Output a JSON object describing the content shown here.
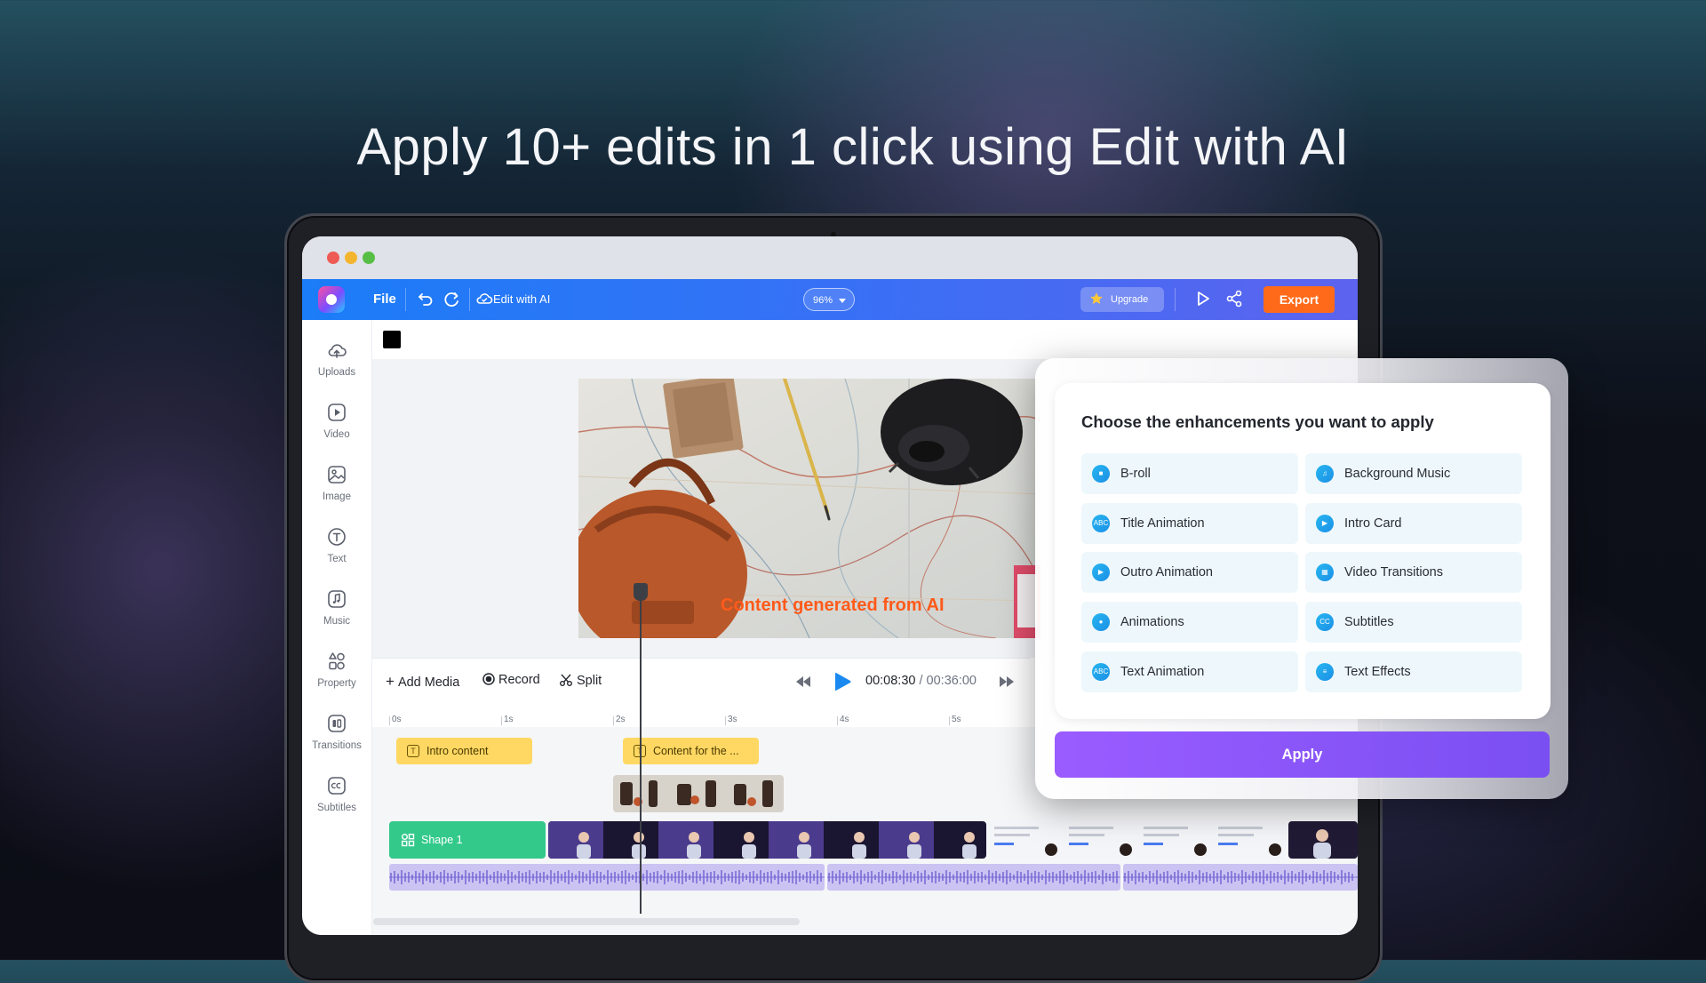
{
  "headline": "Apply 10+ edits in 1 click using Edit with AI",
  "toolbar": {
    "file_label": "File",
    "edit_with_ai_label": "Edit with AI",
    "zoom_value": "96%",
    "upgrade_label": "Upgrade",
    "export_label": "Export"
  },
  "sidebar": {
    "items": [
      {
        "label": "Uploads",
        "icon": "cloud-upload-icon"
      },
      {
        "label": "Video",
        "icon": "video-play-icon"
      },
      {
        "label": "Image",
        "icon": "image-icon"
      },
      {
        "label": "Text",
        "icon": "text-icon"
      },
      {
        "label": "Music",
        "icon": "music-note-icon"
      },
      {
        "label": "Property",
        "icon": "grid-shapes-icon"
      },
      {
        "label": "Transitions",
        "icon": "transitions-icon"
      },
      {
        "label": "Subtitles",
        "icon": "cc-icon"
      }
    ]
  },
  "canvas": {
    "caption": "Content generated from AI"
  },
  "timeline": {
    "add_media_label": "Add Media",
    "record_label": "Record",
    "split_label": "Split",
    "current_time": "00:08:30",
    "separator": "/",
    "total_time": "00:36:00",
    "ruler_labels": [
      "0s",
      "1s",
      "2s",
      "3s",
      "4s",
      "5s"
    ],
    "text_clips": [
      "Intro content",
      "Content for the ..."
    ],
    "shape_clip_label": "Shape 1"
  },
  "enhancements_panel": {
    "title": "Choose the enhancements you want to apply",
    "options": [
      {
        "label": "B-roll",
        "icon": "broll-icon"
      },
      {
        "label": "Background Music",
        "icon": "music-icon"
      },
      {
        "label": "Title Animation",
        "icon": "abc-icon"
      },
      {
        "label": "Intro Card",
        "icon": "play-circle-icon"
      },
      {
        "label": "Outro Animation",
        "icon": "play-circle-icon"
      },
      {
        "label": "Video Transitions",
        "icon": "transitions-icon"
      },
      {
        "label": "Animations",
        "icon": "animation-icon"
      },
      {
        "label": "Subtitles",
        "icon": "cc-icon"
      },
      {
        "label": "Text Animation",
        "icon": "abc-icon"
      },
      {
        "label": "Text Effects",
        "icon": "text-effects-icon"
      }
    ],
    "apply_label": "Apply"
  },
  "colors": {
    "accent_blue": "#1b7df8",
    "export_orange": "#ff6a1a",
    "apply_purple": "#8a55f8",
    "caption_orange": "#ff5a1a",
    "text_clip_yellow": "#ffd863",
    "shape_clip_green": "#33c98b",
    "audio_lavender": "#cbc3f2"
  }
}
